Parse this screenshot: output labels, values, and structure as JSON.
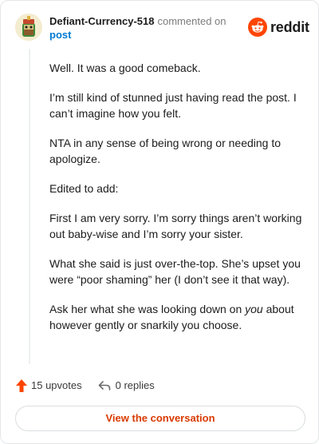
{
  "header": {
    "author": "Defiant-Currency-518",
    "action_text": "commented on",
    "post_link": "post",
    "brand_wordmark": "reddit"
  },
  "comment": {
    "paragraphs": [
      "Well. It was a good comeback.",
      "I’m still kind of stunned just having read the post. I can’t imagine how you felt.",
      "NTA in any sense of being wrong or needing to apologize.",
      "Edited to add:",
      "First I am very sorry. I’m sorry things aren’t working out baby-wise and I’m sorry your sister.",
      "What she said is just over-the-top. She’s upset you were “poor shaming” her (I don’t see it that way)."
    ],
    "last_paragraph": {
      "before": "Ask her what she was looking down on ",
      "emphasis": "you",
      "after": " about however gently or snarkily you choose."
    }
  },
  "footer": {
    "upvotes": "15 upvotes",
    "replies": "0 replies",
    "view_button": "View the conversation"
  },
  "colors": {
    "brand_orange": "#ff4500",
    "link_blue": "#0079d3",
    "button_text": "#d93a00"
  },
  "icons": {
    "upvote": "upvote-arrow-icon",
    "reply": "reply-arrow-icon",
    "brand": "reddit-snoo-icon",
    "avatar": "user-avatar"
  }
}
